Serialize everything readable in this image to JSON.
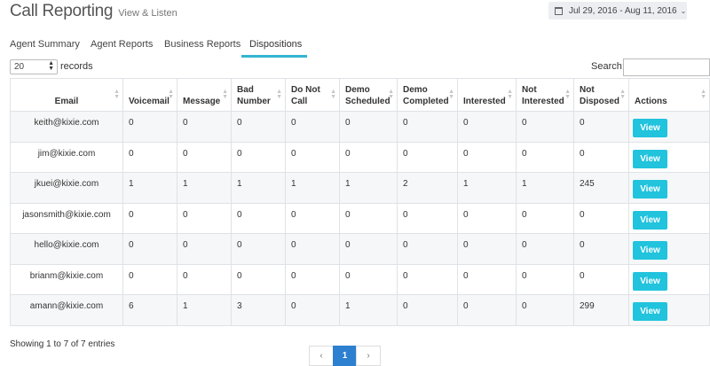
{
  "header": {
    "title": "Call Reporting",
    "subtitle": "View & Listen",
    "date_range": "Jul 29, 2016 - Aug 11, 2016",
    "date_icon": "calendar-icon",
    "date_chevron": "chevron-down-icon"
  },
  "tabs": [
    {
      "label": "Agent Summary",
      "active": false
    },
    {
      "label": "Agent Reports",
      "active": false
    },
    {
      "label": "Business Reports",
      "active": false
    },
    {
      "label": "Dispositions",
      "active": true
    }
  ],
  "controls": {
    "page_length": "20",
    "records_label": "records",
    "search_label": "Search:",
    "search_value": ""
  },
  "table": {
    "columns": [
      {
        "label": "Email"
      },
      {
        "label": "Voicemail"
      },
      {
        "label": "Message"
      },
      {
        "label": "Bad Number"
      },
      {
        "label": "Do Not Call"
      },
      {
        "label": "Demo Scheduled"
      },
      {
        "label": "Demo Completed"
      },
      {
        "label": "Interested"
      },
      {
        "label": "Not Interested"
      },
      {
        "label": "Not Disposed"
      },
      {
        "label": "Actions"
      }
    ],
    "action_label": "View",
    "rows": [
      {
        "email": "keith@kixie.com",
        "voicemail": "0",
        "message": "0",
        "bad_number": "0",
        "do_not_call": "0",
        "demo_scheduled": "0",
        "demo_completed": "0",
        "interested": "0",
        "not_interested": "0",
        "not_disposed": "0"
      },
      {
        "email": "jim@kixie.com",
        "voicemail": "0",
        "message": "0",
        "bad_number": "0",
        "do_not_call": "0",
        "demo_scheduled": "0",
        "demo_completed": "0",
        "interested": "0",
        "not_interested": "0",
        "not_disposed": "0"
      },
      {
        "email": "jkuei@kixie.com",
        "voicemail": "1",
        "message": "1",
        "bad_number": "1",
        "do_not_call": "1",
        "demo_scheduled": "1",
        "demo_completed": "2",
        "interested": "1",
        "not_interested": "1",
        "not_disposed": "245"
      },
      {
        "email": "jasonsmith@kixie.com",
        "voicemail": "0",
        "message": "0",
        "bad_number": "0",
        "do_not_call": "0",
        "demo_scheduled": "0",
        "demo_completed": "0",
        "interested": "0",
        "not_interested": "0",
        "not_disposed": "0"
      },
      {
        "email": "hello@kixie.com",
        "voicemail": "0",
        "message": "0",
        "bad_number": "0",
        "do_not_call": "0",
        "demo_scheduled": "0",
        "demo_completed": "0",
        "interested": "0",
        "not_interested": "0",
        "not_disposed": "0"
      },
      {
        "email": "brianm@kixie.com",
        "voicemail": "0",
        "message": "0",
        "bad_number": "0",
        "do_not_call": "0",
        "demo_scheduled": "0",
        "demo_completed": "0",
        "interested": "0",
        "not_interested": "0",
        "not_disposed": "0"
      },
      {
        "email": "amann@kixie.com",
        "voicemail": "6",
        "message": "1",
        "bad_number": "3",
        "do_not_call": "0",
        "demo_scheduled": "1",
        "demo_completed": "0",
        "interested": "0",
        "not_interested": "0",
        "not_disposed": "299"
      }
    ]
  },
  "footer": {
    "info": "Showing 1 to 7 of 7 entries",
    "pager": {
      "prev": "‹",
      "current": "1",
      "next": "›"
    }
  },
  "colors": {
    "accent": "#21c3dd",
    "tab_underline": "#33b5d0",
    "pager_active": "#2d7fd0"
  }
}
